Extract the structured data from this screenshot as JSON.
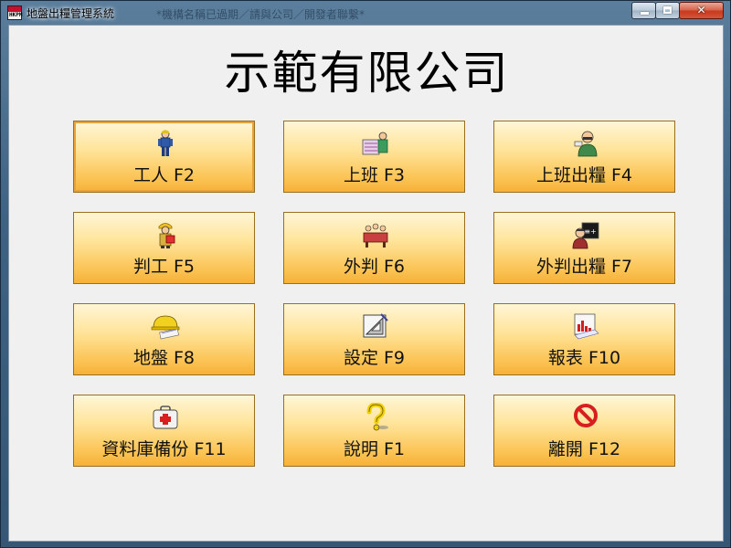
{
  "window": {
    "title": "地盤出糧管理系統",
    "ghost_title": "*機構名稱已過期／請與公司／開發者聯繫*",
    "icon_text": "HKPM"
  },
  "company": {
    "name": "示範有限公司"
  },
  "menu": [
    {
      "label": "工人  F2",
      "icon": "worker-icon"
    },
    {
      "label": "上班  F3",
      "icon": "attendance-icon"
    },
    {
      "label": "上班出糧  F4",
      "icon": "payroll-icon"
    },
    {
      "label": "判工  F5",
      "icon": "subcontractor-icon"
    },
    {
      "label": "外判  F6",
      "icon": "outsource-icon"
    },
    {
      "label": "外判出糧  F7",
      "icon": "outsource-payroll-icon"
    },
    {
      "label": "地盤  F8",
      "icon": "site-icon"
    },
    {
      "label": "設定  F9",
      "icon": "settings-icon"
    },
    {
      "label": "報表  F10",
      "icon": "report-icon"
    },
    {
      "label": "資料庫備份  F11",
      "icon": "backup-icon"
    },
    {
      "label": "說明  F1",
      "icon": "help-icon"
    },
    {
      "label": "離開  F12",
      "icon": "exit-icon"
    }
  ],
  "colors": {
    "button_top": "#fff6d6",
    "button_bottom": "#f6b138",
    "button_border": "#9a6e1c",
    "exit_red": "#d81e1e"
  }
}
